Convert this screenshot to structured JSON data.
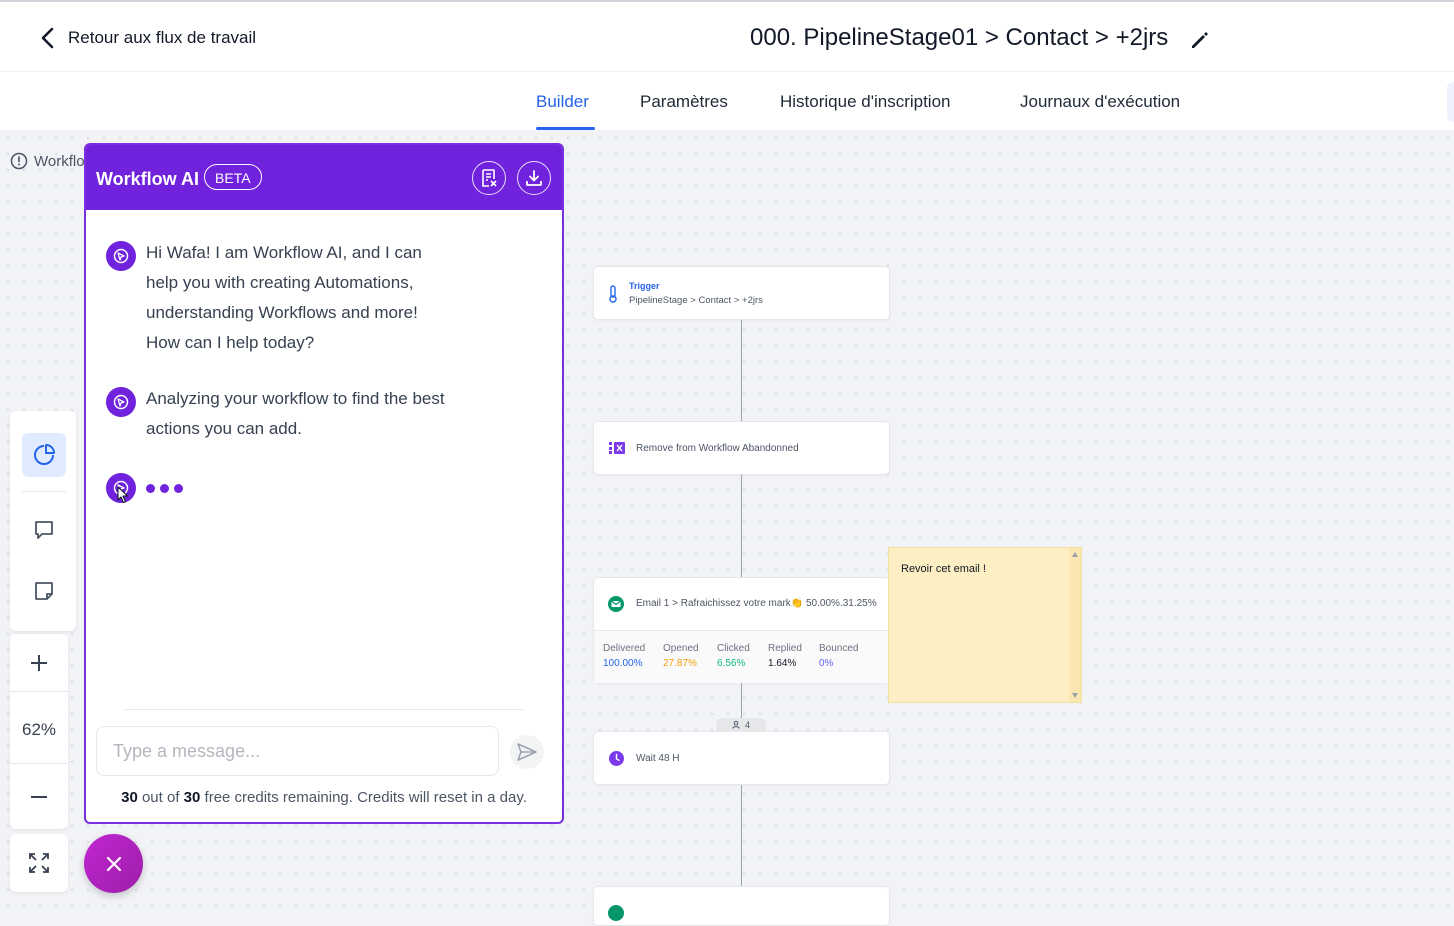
{
  "header": {
    "back_label": "Retour aux flux de travail",
    "workflow_title": "000. PipelineStage01 > Contact > +2jrs"
  },
  "tabs": [
    {
      "label": "Builder",
      "active": true
    },
    {
      "label": "Paramètres",
      "active": false
    },
    {
      "label": "Historique d'inscription",
      "active": false
    },
    {
      "label": "Journaux d'exécution",
      "active": false
    }
  ],
  "canvas": {
    "warning_text": "Workflo"
  },
  "toolbar": {
    "zoom_level": "62%"
  },
  "ai_panel": {
    "title": "Workflow AI",
    "badge": "BETA",
    "messages": [
      {
        "text": "Hi Wafa! I am Workflow AI, and I can help you with creating Automations, understanding Workflows and more! How can I help today?"
      },
      {
        "text": "Analyzing your workflow to find the best actions you can add."
      }
    ],
    "input_placeholder": "Type a message...",
    "credits": {
      "used": "30",
      "mid": " out of ",
      "total": "30",
      "suffix": " free credits remaining. Credits will reset in a day."
    }
  },
  "nodes": {
    "trigger": {
      "label": "Trigger",
      "subtitle": "PipelineStage > Contact > +2jrs"
    },
    "remove": {
      "label": "Remove from Workflow Abandonned"
    },
    "email": {
      "label": "Email 1 > Rafraichissez votre mark👏 50.00%.31.25%",
      "stats": [
        {
          "label": "Delivered",
          "value": "100.00%",
          "color": "#2563eb"
        },
        {
          "label": "Opened",
          "value": "27.87%",
          "color": "#f59e0b"
        },
        {
          "label": "Clicked",
          "value": "6.56%",
          "color": "#10b981"
        },
        {
          "label": "Replied",
          "value": "1.64%",
          "color": "#111827"
        },
        {
          "label": "Bounced",
          "value": "0%",
          "color": "#6366f1"
        }
      ]
    },
    "wait_count": "4",
    "wait": {
      "label": "Wait 48 H"
    }
  },
  "sticky_note": {
    "text": "Revoir cet email !"
  },
  "colors": {
    "accent": "#2563eb",
    "ai_purple": "#7022dd",
    "fab": "#c026d3"
  }
}
